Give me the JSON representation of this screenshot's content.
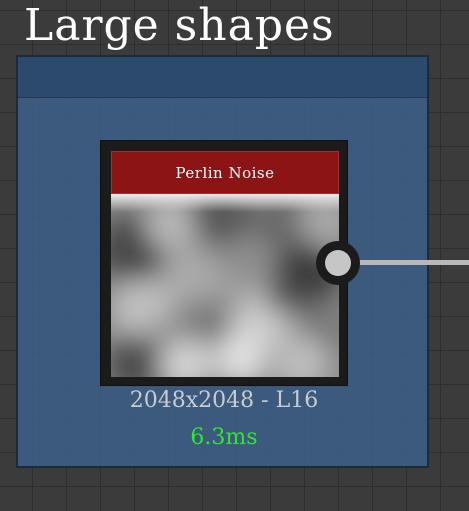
{
  "group": {
    "title": "Large shapes"
  },
  "node": {
    "title": "Perlin Noise",
    "resolution_label": "2048x2048 - L16",
    "cook_time": "6.3ms",
    "header_color": "#8c1414",
    "time_color": "#2ee82e",
    "preview": "perlin-noise-texture"
  },
  "colors": {
    "canvas_background": "#3b3b3b",
    "group_frame": "#3c5a7d",
    "group_header": "#2b4a6c",
    "node_body": "#1b1b1b",
    "wire": "#b8b8b8"
  }
}
